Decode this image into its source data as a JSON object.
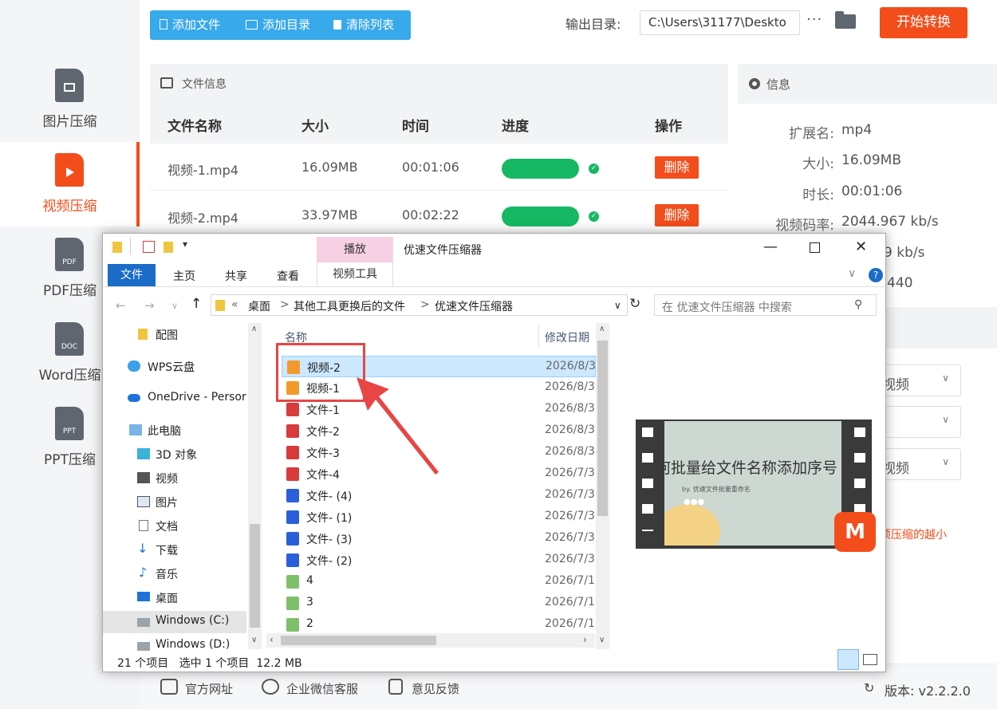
{
  "sidebar": {
    "items": [
      {
        "label": "图片压缩",
        "icon": "image-file-icon",
        "tag": ""
      },
      {
        "label": "视频压缩",
        "icon": "video-file-icon",
        "tag": ""
      },
      {
        "label": "PDF压缩",
        "icon": "pdf-file-icon",
        "tag": "PDF"
      },
      {
        "label": "Word压缩",
        "icon": "doc-file-icon",
        "tag": "DOC"
      },
      {
        "label": "PPT压缩",
        "icon": "ppt-file-icon",
        "tag": "PPT"
      }
    ],
    "active_index": 1
  },
  "toolbar": {
    "add_file": "添加文件",
    "add_dir": "添加目录",
    "clear_list": "清除列表",
    "output_label": "输出目录:",
    "output_path": "C:\\Users\\31177\\Deskto",
    "more": "···",
    "start": "开始转换"
  },
  "file_panel": {
    "title": "文件信息",
    "columns": [
      "文件名称",
      "大小",
      "时间",
      "进度",
      "操作"
    ],
    "rows": [
      {
        "name": "视频-1.mp4",
        "size": "16.09MB",
        "time": "00:01:06",
        "progress": 1.0,
        "action": "删除"
      },
      {
        "name": "视频-2.mp4",
        "size": "33.97MB",
        "time": "00:02:22",
        "progress": 1.0,
        "action": "删除"
      }
    ]
  },
  "info_panel": {
    "title": "信息",
    "fields": [
      {
        "key": "扩展名:",
        "value": "mp4"
      },
      {
        "key": "大小:",
        "value": "16.09MB"
      },
      {
        "key": "时长:",
        "value": "00:01:06"
      },
      {
        "key": "视频码率:",
        "value": "2044.967 kb/s"
      }
    ],
    "partial_values": [
      "9 kb/s",
      "440"
    ],
    "selects": [
      "视频",
      "",
      "视频"
    ],
    "hint": "项压缩的越小"
  },
  "footer": {
    "website": "官方网址",
    "wechat": "企业微信客服",
    "feedback": "意见反馈",
    "version": "版本: v2.2.2.0"
  },
  "explorer": {
    "title": "优速文件压缩器",
    "context_tab": "播放",
    "context_sub": "视频工具",
    "ribbon": [
      "文件",
      "主页",
      "共享",
      "查看"
    ],
    "address": [
      "«",
      "桌面",
      ">",
      "其他工具更换后的文件",
      ">",
      "优速文件压缩器"
    ],
    "search_placeholder": "在 优速文件压缩器 中搜索",
    "nav": [
      {
        "label": "配图",
        "icon": "folder-icon"
      },
      {
        "label": "WPS云盘",
        "icon": "cloud-icon"
      },
      {
        "label": "OneDrive - Persor",
        "icon": "onedrive-icon"
      },
      {
        "label": "此电脑",
        "icon": "computer-icon"
      },
      {
        "label": "3D 对象",
        "icon": "cube-icon"
      },
      {
        "label": "视频",
        "icon": "film-icon"
      },
      {
        "label": "图片",
        "icon": "picture-icon"
      },
      {
        "label": "文档",
        "icon": "document-icon"
      },
      {
        "label": "下载",
        "icon": "download-icon"
      },
      {
        "label": "音乐",
        "icon": "music-icon"
      },
      {
        "label": "桌面",
        "icon": "desktop-icon"
      },
      {
        "label": "Windows (C:)",
        "icon": "drive-icon"
      },
      {
        "label": "Windows (D:)",
        "icon": "drive-icon"
      }
    ],
    "col_name": "名称",
    "col_date": "修改日期",
    "files": [
      {
        "name": "视频-2",
        "date": "2026/8/3",
        "type": "video"
      },
      {
        "name": "视频-1",
        "date": "2026/8/3",
        "type": "video"
      },
      {
        "name": "文件-1",
        "date": "2026/8/3",
        "type": "pdf"
      },
      {
        "name": "文件-2",
        "date": "2026/8/3",
        "type": "pdf"
      },
      {
        "name": "文件-3",
        "date": "2026/8/3",
        "type": "pdf"
      },
      {
        "name": "文件-4",
        "date": "2026/7/3",
        "type": "pdf"
      },
      {
        "name": "文件- (4)",
        "date": "2026/7/3",
        "type": "word"
      },
      {
        "name": "文件- (1)",
        "date": "2026/7/3",
        "type": "word"
      },
      {
        "name": "文件- (3)",
        "date": "2026/7/3",
        "type": "word"
      },
      {
        "name": "文件- (2)",
        "date": "2026/7/3",
        "type": "word"
      },
      {
        "name": "4",
        "date": "2026/7/1",
        "type": "sheet"
      },
      {
        "name": "3",
        "date": "2026/7/1",
        "type": "sheet"
      },
      {
        "name": "2",
        "date": "2026/7/1",
        "type": "sheet"
      }
    ],
    "status_count": "21 个项目",
    "status_selected": "选中 1 个项目",
    "status_size": "12.2 MB",
    "preview": {
      "title": "如何批量给文件名称添加序号",
      "subtitle": "by. 优速文件批量重命名"
    }
  },
  "colors": {
    "accent": "#f24d1b",
    "toolbar_blue": "#38a9ea",
    "progress_green": "#17b864",
    "annotation_red": "#e84545"
  }
}
